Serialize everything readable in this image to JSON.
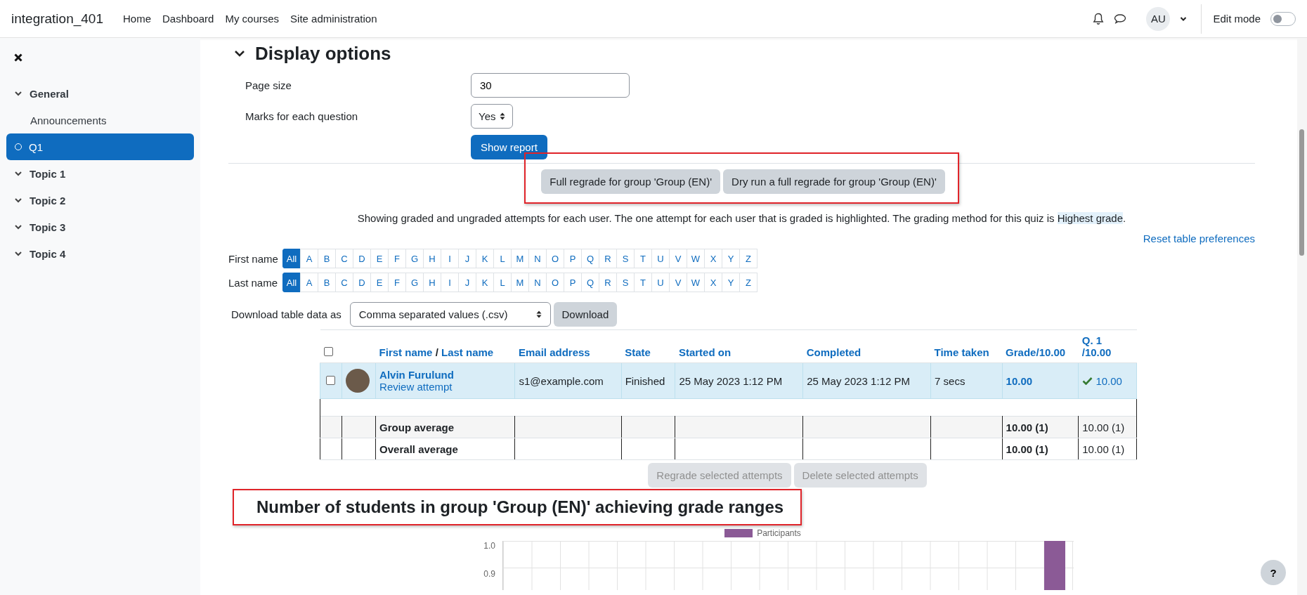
{
  "header": {
    "site_name": "integration_401",
    "nav": [
      "Home",
      "Dashboard",
      "My courses",
      "Site administration"
    ],
    "avatar_initials": "AU",
    "edit_mode": {
      "label": "Edit mode",
      "on": false
    }
  },
  "sidebar": {
    "items": [
      {
        "label": "General",
        "children": [
          {
            "label": "Announcements",
            "kind": "activity",
            "selected": false
          },
          {
            "label": "Q1",
            "kind": "quiz",
            "selected": true
          }
        ]
      },
      {
        "label": "Topic 1"
      },
      {
        "label": "Topic 2"
      },
      {
        "label": "Topic 3"
      },
      {
        "label": "Topic 4"
      }
    ]
  },
  "display_options": {
    "title": "Display options",
    "expanded": true,
    "fields": [
      {
        "label": "Page size",
        "kind": "text",
        "value": "30"
      },
      {
        "label": "Marks for each question",
        "kind": "select",
        "value": "Yes"
      }
    ],
    "submit": "Show report"
  },
  "regrade": {
    "highlighted": true,
    "buttons": [
      "Full regrade for group 'Group (EN)'",
      "Dry run a full regrade for group 'Group (EN)'"
    ]
  },
  "info": {
    "text": "Showing graded and ungraded attempts for each user. The one attempt for each user that is graded is highlighted. The grading method for this quiz is ",
    "highlight": "Highest grade",
    "end": "."
  },
  "reset_link": "Reset table preferences",
  "initials_filters": [
    {
      "label": "First name",
      "letters": [
        {
          "label": "All",
          "selected": true
        },
        {
          "label": "A",
          "selected": false
        },
        {
          "label": "B",
          "selected": false
        },
        {
          "label": "C",
          "selected": false
        },
        {
          "label": "D",
          "selected": false
        },
        {
          "label": "E",
          "selected": false
        },
        {
          "label": "F",
          "selected": false
        },
        {
          "label": "G",
          "selected": false
        },
        {
          "label": "H",
          "selected": false
        },
        {
          "label": "I",
          "selected": false
        },
        {
          "label": "J",
          "selected": false
        },
        {
          "label": "K",
          "selected": false
        },
        {
          "label": "L",
          "selected": false
        },
        {
          "label": "M",
          "selected": false
        },
        {
          "label": "N",
          "selected": false
        },
        {
          "label": "O",
          "selected": false
        },
        {
          "label": "P",
          "selected": false
        },
        {
          "label": "Q",
          "selected": false
        },
        {
          "label": "R",
          "selected": false
        },
        {
          "label": "S",
          "selected": false
        },
        {
          "label": "T",
          "selected": false
        },
        {
          "label": "U",
          "selected": false
        },
        {
          "label": "V",
          "selected": false
        },
        {
          "label": "W",
          "selected": false
        },
        {
          "label": "X",
          "selected": false
        },
        {
          "label": "Y",
          "selected": false
        },
        {
          "label": "Z",
          "selected": false
        }
      ]
    },
    {
      "label": "Last name",
      "letters": [
        {
          "label": "All",
          "selected": true
        },
        {
          "label": "A",
          "selected": false
        },
        {
          "label": "B",
          "selected": false
        },
        {
          "label": "C",
          "selected": false
        },
        {
          "label": "D",
          "selected": false
        },
        {
          "label": "E",
          "selected": false
        },
        {
          "label": "F",
          "selected": false
        },
        {
          "label": "G",
          "selected": false
        },
        {
          "label": "H",
          "selected": false
        },
        {
          "label": "I",
          "selected": false
        },
        {
          "label": "J",
          "selected": false
        },
        {
          "label": "K",
          "selected": false
        },
        {
          "label": "L",
          "selected": false
        },
        {
          "label": "M",
          "selected": false
        },
        {
          "label": "N",
          "selected": false
        },
        {
          "label": "O",
          "selected": false
        },
        {
          "label": "P",
          "selected": false
        },
        {
          "label": "Q",
          "selected": false
        },
        {
          "label": "R",
          "selected": false
        },
        {
          "label": "S",
          "selected": false
        },
        {
          "label": "T",
          "selected": false
        },
        {
          "label": "U",
          "selected": false
        },
        {
          "label": "V",
          "selected": false
        },
        {
          "label": "W",
          "selected": false
        },
        {
          "label": "X",
          "selected": false
        },
        {
          "label": "Y",
          "selected": false
        },
        {
          "label": "Z",
          "selected": false
        }
      ]
    }
  ],
  "download": {
    "label": "Download table data as",
    "format": "Comma separated values (.csv)",
    "button": "Download"
  },
  "table": {
    "select_all_checked": false,
    "first_name": "First name",
    "separator": "/",
    "last_name": "Last name",
    "columns": [
      "Email address",
      "State",
      "Started on",
      "Completed",
      "Time taken",
      "Grade/10.00",
      "Q. 1 /10.00"
    ],
    "rows": [
      {
        "selected": true,
        "checked": false,
        "name": "Alvin Furulund",
        "review": "Review attempt",
        "email": "s1@example.com",
        "state": "Finished",
        "started": "25 May 2023 1:12 PM",
        "completed": "25 May 2023 1:12 PM",
        "time": "7 secs",
        "grade": "10.00",
        "q1": "10.00",
        "q1_correct": true
      }
    ],
    "averages": [
      {
        "label": "Group average",
        "grade": "10.00 (1)",
        "q1": "10.00 (1)"
      },
      {
        "label": "Overall average",
        "grade": "10.00 (1)",
        "q1": "10.00 (1)"
      }
    ]
  },
  "bulk_buttons": [
    {
      "label": "Regrade selected attempts",
      "disabled": true
    },
    {
      "label": "Delete selected attempts",
      "disabled": true
    }
  ],
  "chart": {
    "title": "Number of students in group 'Group (EN)' achieving grade ranges",
    "highlighted": true,
    "legend": "Participants",
    "color": "#8b5a96",
    "y_tick_labels": [
      "1.0",
      "0.9"
    ]
  },
  "help_button": "?"
}
